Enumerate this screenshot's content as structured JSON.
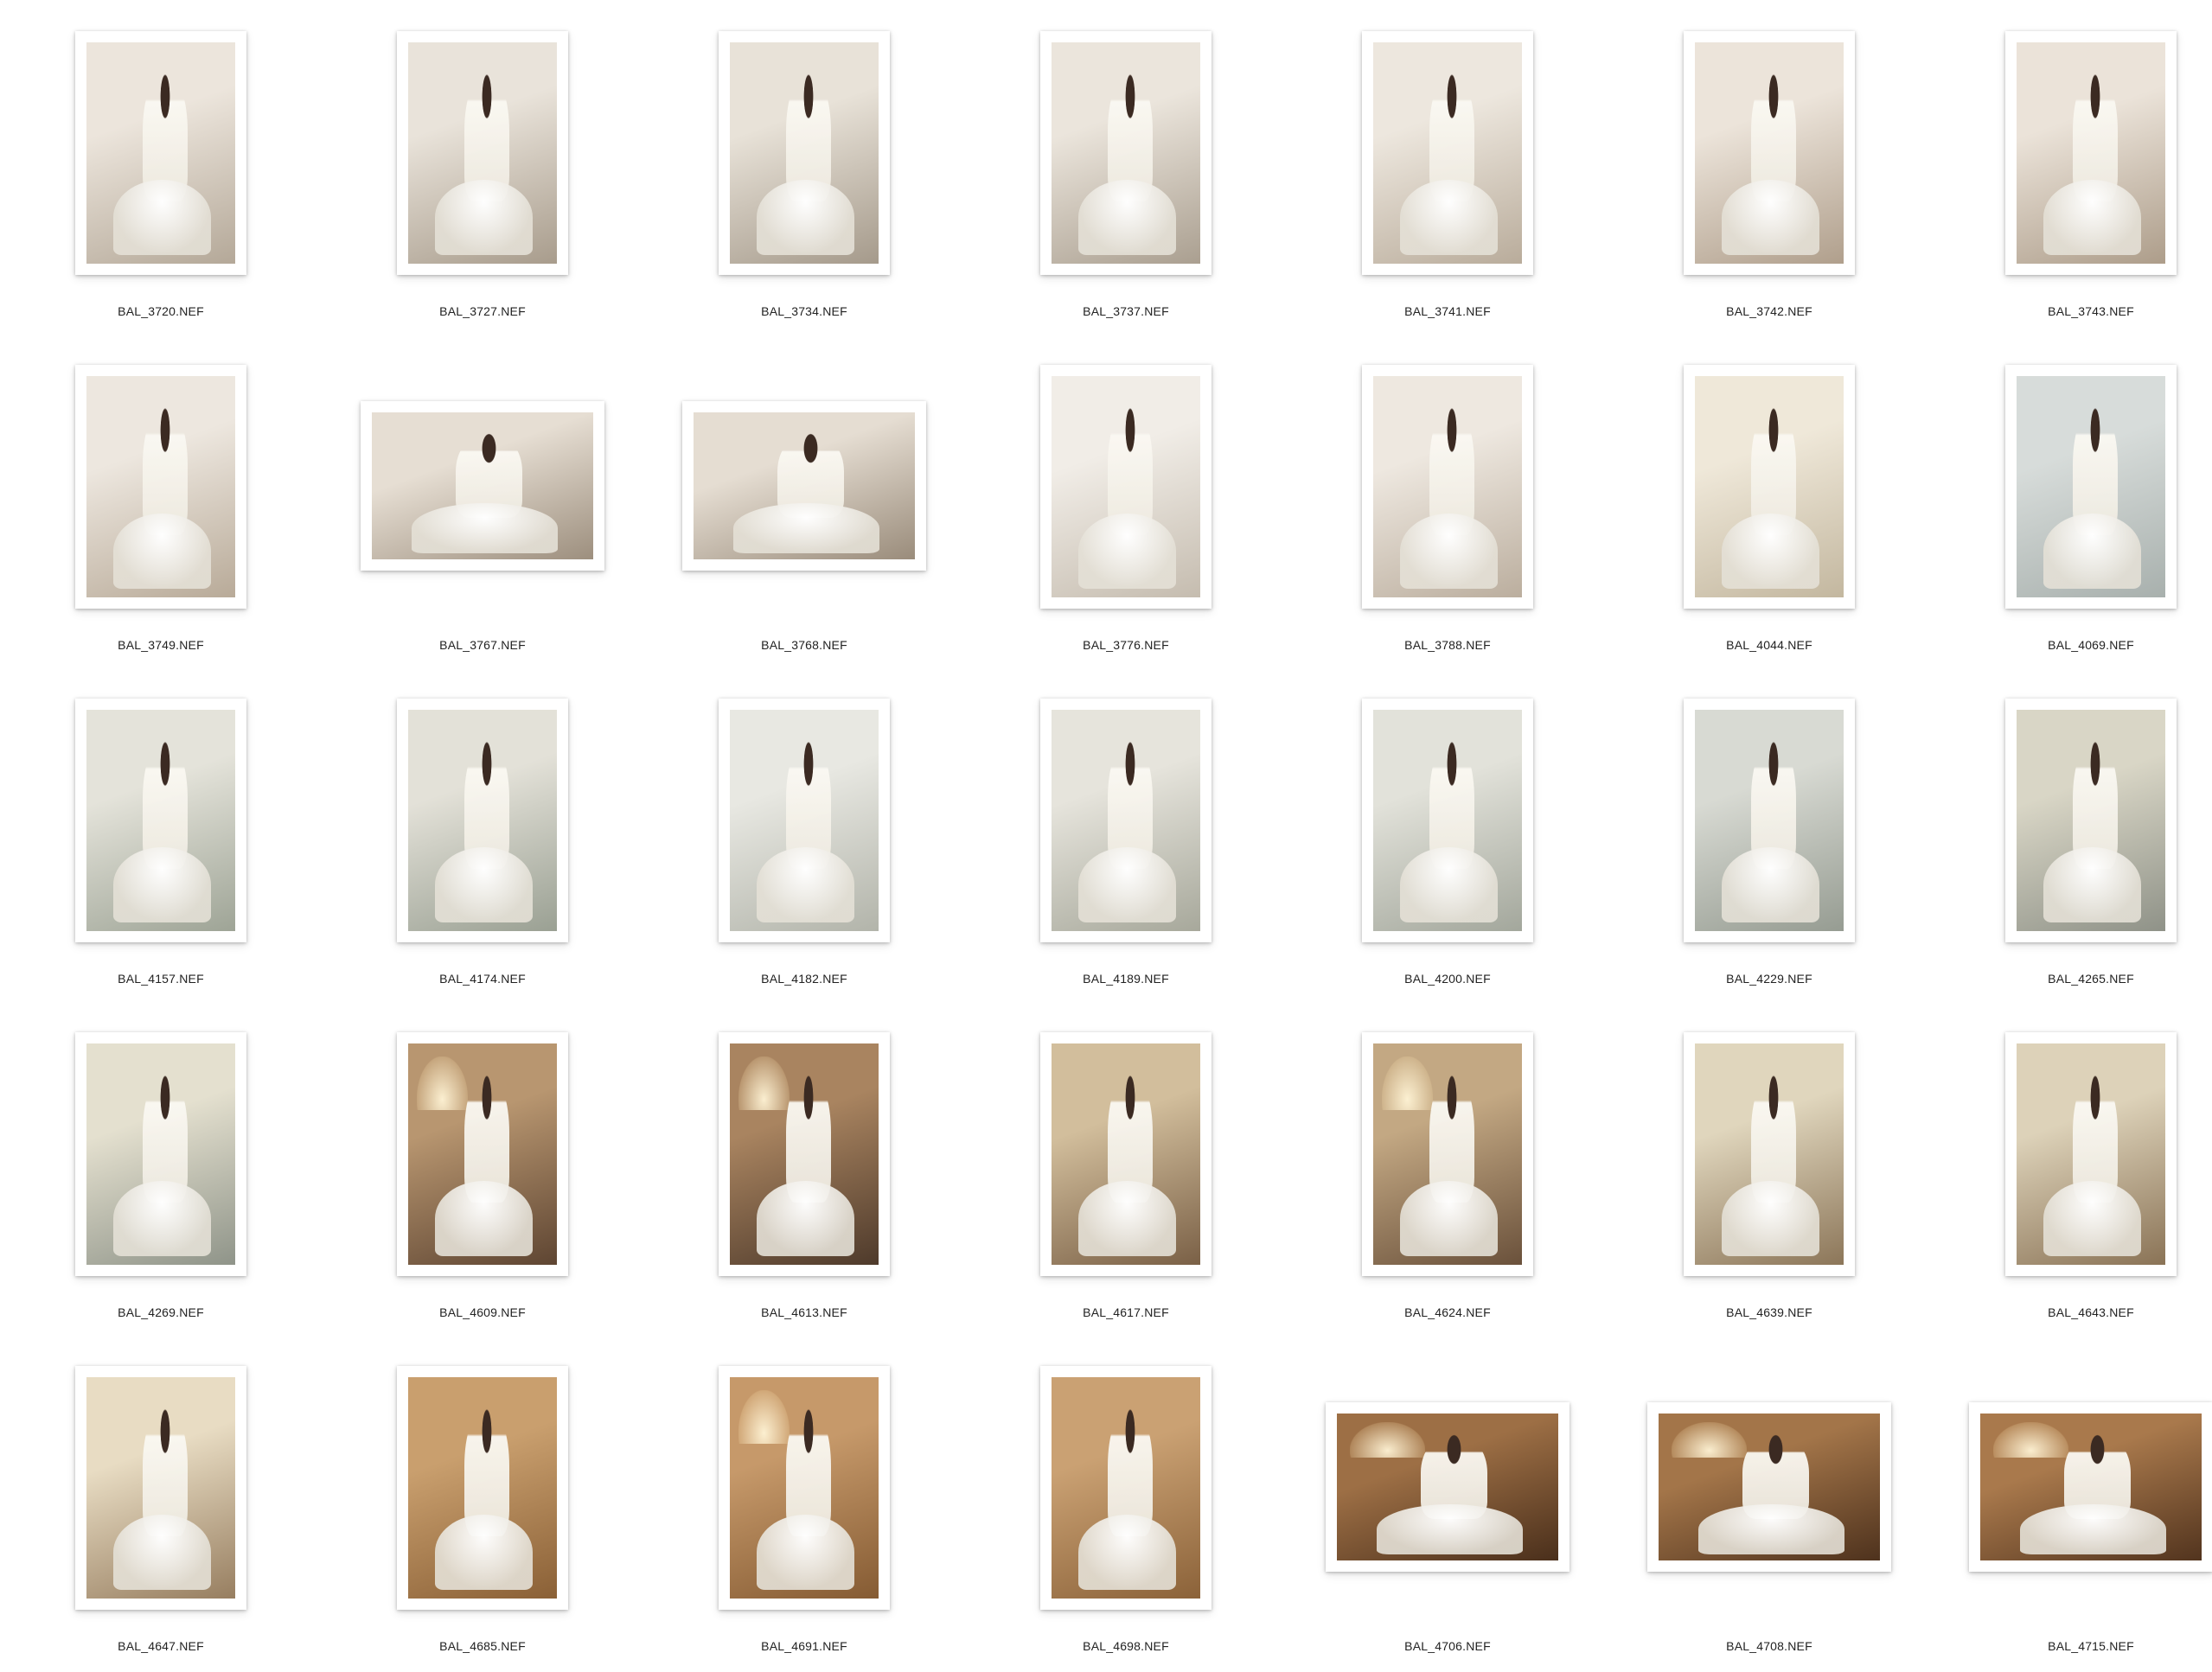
{
  "photos": [
    {
      "name": "BAL_3720.NEF",
      "orientation": "portrait",
      "tone": [
        "#ece5dc",
        "#b4a898"
      ]
    },
    {
      "name": "BAL_3727.NEF",
      "orientation": "portrait",
      "tone": [
        "#e9e3da",
        "#a89c8c"
      ]
    },
    {
      "name": "BAL_3734.NEF",
      "orientation": "portrait",
      "tone": [
        "#e8e2d8",
        "#a59a8b"
      ]
    },
    {
      "name": "BAL_3737.NEF",
      "orientation": "portrait",
      "tone": [
        "#ebe5dc",
        "#aa9f90"
      ]
    },
    {
      "name": "BAL_3741.NEF",
      "orientation": "portrait",
      "tone": [
        "#ede7de",
        "#b9ac9b"
      ]
    },
    {
      "name": "BAL_3742.NEF",
      "orientation": "portrait",
      "tone": [
        "#ece4da",
        "#b09f8c"
      ]
    },
    {
      "name": "BAL_3743.NEF",
      "orientation": "portrait",
      "tone": [
        "#ebe3d9",
        "#ad9d8a"
      ]
    },
    {
      "name": "BAL_3749.NEF",
      "orientation": "portrait",
      "tone": [
        "#ede7df",
        "#b8aa98"
      ]
    },
    {
      "name": "BAL_3767.NEF",
      "orientation": "landscape",
      "tone": [
        "#e6ded3",
        "#9d8f7e"
      ]
    },
    {
      "name": "BAL_3768.NEF",
      "orientation": "landscape",
      "tone": [
        "#e5ddd2",
        "#9a8c7b"
      ]
    },
    {
      "name": "BAL_3776.NEF",
      "orientation": "portrait",
      "tone": [
        "#f1ede7",
        "#c5bcaf"
      ]
    },
    {
      "name": "BAL_3788.NEF",
      "orientation": "portrait",
      "tone": [
        "#eee8e0",
        "#bbae9e"
      ]
    },
    {
      "name": "BAL_4044.NEF",
      "orientation": "portrait",
      "tone": [
        "#efe8d9",
        "#c3b79f"
      ]
    },
    {
      "name": "BAL_4069.NEF",
      "orientation": "portrait",
      "tone": [
        "#d7dcda",
        "#a8b0ad"
      ]
    },
    {
      "name": "BAL_4157.NEF",
      "orientation": "portrait",
      "tone": [
        "#e4e3da",
        "#9ea496"
      ]
    },
    {
      "name": "BAL_4174.NEF",
      "orientation": "portrait",
      "tone": [
        "#e3e1d8",
        "#9aa093"
      ]
    },
    {
      "name": "BAL_4182.NEF",
      "orientation": "portrait",
      "tone": [
        "#e8e8e2",
        "#b2b4aa"
      ]
    },
    {
      "name": "BAL_4189.NEF",
      "orientation": "portrait",
      "tone": [
        "#e6e4dc",
        "#a7a89b"
      ]
    },
    {
      "name": "BAL_4200.NEF",
      "orientation": "portrait",
      "tone": [
        "#e2e2da",
        "#a3a79c"
      ]
    },
    {
      "name": "BAL_4229.NEF",
      "orientation": "portrait",
      "tone": [
        "#d8dad3",
        "#969c92"
      ]
    },
    {
      "name": "BAL_4265.NEF",
      "orientation": "portrait",
      "tone": [
        "#d9d6c6",
        "#8f9288"
      ]
    },
    {
      "name": "BAL_4269.NEF",
      "orientation": "portrait",
      "tone": [
        "#e4e0cf",
        "#8f9489"
      ]
    },
    {
      "name": "BAL_4609.NEF",
      "orientation": "portrait",
      "tone": [
        "#b89670",
        "#5e4532"
      ]
    },
    {
      "name": "BAL_4613.NEF",
      "orientation": "portrait",
      "tone": [
        "#a98460",
        "#4e3a2b"
      ]
    },
    {
      "name": "BAL_4617.NEF",
      "orientation": "portrait",
      "tone": [
        "#d2be9c",
        "#7a6046"
      ]
    },
    {
      "name": "BAL_4624.NEF",
      "orientation": "portrait",
      "tone": [
        "#c3a883",
        "#6a513b"
      ]
    },
    {
      "name": "BAL_4639.NEF",
      "orientation": "portrait",
      "tone": [
        "#e0d6bd",
        "#8c7659"
      ]
    },
    {
      "name": "BAL_4643.NEF",
      "orientation": "portrait",
      "tone": [
        "#ddd2b9",
        "#8a7356"
      ]
    },
    {
      "name": "BAL_4647.NEF",
      "orientation": "portrait",
      "tone": [
        "#e8dcc3",
        "#977e60"
      ]
    },
    {
      "name": "BAL_4685.NEF",
      "orientation": "portrait",
      "tone": [
        "#c99f6e",
        "#8a6036"
      ]
    },
    {
      "name": "BAL_4691.NEF",
      "orientation": "portrait",
      "tone": [
        "#c6996a",
        "#855b33"
      ]
    },
    {
      "name": "BAL_4698.NEF",
      "orientation": "portrait",
      "tone": [
        "#caa173",
        "#8b6239"
      ]
    },
    {
      "name": "BAL_4706.NEF",
      "orientation": "landscape",
      "tone": [
        "#9d6f45",
        "#4a2f1b"
      ]
    },
    {
      "name": "BAL_4708.NEF",
      "orientation": "landscape",
      "tone": [
        "#a37549",
        "#4e321d"
      ]
    },
    {
      "name": "BAL_4715.NEF",
      "orientation": "landscape",
      "tone": [
        "#a9794c",
        "#52341e"
      ]
    }
  ]
}
